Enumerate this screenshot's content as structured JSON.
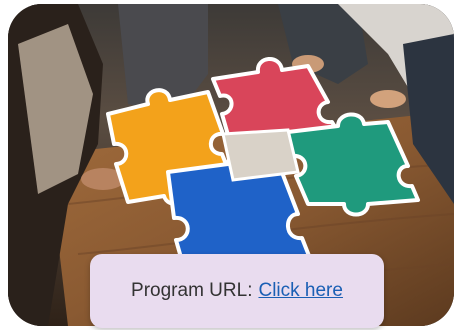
{
  "image": {
    "description_icon": "puzzle-pieces-photo-icon"
  },
  "program": {
    "label": "Program URL:",
    "link_text": "Click here"
  },
  "colors": {
    "caption_bg": "#e9dcef",
    "link": "#1a5fb4",
    "puzzle_yellow": "#f3a21b",
    "puzzle_red": "#d9455a",
    "puzzle_green": "#1f9a7d",
    "puzzle_blue": "#1f62c8",
    "table_wood": "#8a5a32"
  }
}
